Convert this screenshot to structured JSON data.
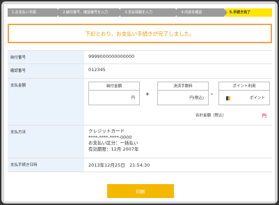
{
  "steps": [
    "1.お支払い手順",
    "2.納付番号、確認番号を入力",
    "3.支払情報を入力",
    "4.内容を確認",
    "5.手続き完了"
  ],
  "notice": "下記とおり、お支払い手続きが完了しました。",
  "rows": {
    "payment_number": {
      "label": "納付番号",
      "value": "9999000000000000"
    },
    "confirm_number": {
      "label": "確認番号",
      "value": "012345"
    },
    "amount": {
      "label": "支払金額",
      "boxes": [
        {
          "title": "納付金額",
          "value": "円"
        },
        {
          "title": "決済手数料",
          "value": "円(税込)"
        },
        {
          "title": "ポイント利用",
          "value": "ポイント"
        }
      ],
      "ops": [
        "+",
        "-"
      ],
      "total_label": "合計金額（税込）",
      "total_value": "円"
    },
    "method": {
      "label": "支払方法",
      "lines": [
        "クレジットカード",
        "****-****-****-0000",
        "お支払い区分：一括払い",
        "有効期限：12月 2007年"
      ]
    },
    "datetime": {
      "label": "支払手続き日時",
      "value": "2013年12月25日　21:54:30"
    }
  },
  "print_button": "印刷",
  "colors": {
    "accent": "#ffe600",
    "notice": "#f39800",
    "button": "#f5b800",
    "total": "#e4002b"
  }
}
